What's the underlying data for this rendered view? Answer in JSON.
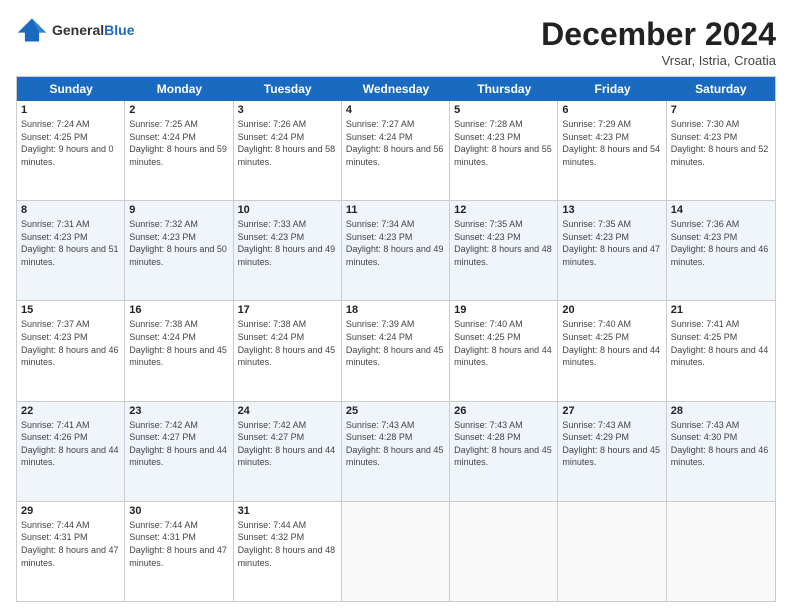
{
  "header": {
    "logo_general": "General",
    "logo_blue": "Blue",
    "title": "December 2024",
    "location": "Vrsar, Istria, Croatia"
  },
  "weekdays": [
    "Sunday",
    "Monday",
    "Tuesday",
    "Wednesday",
    "Thursday",
    "Friday",
    "Saturday"
  ],
  "rows": [
    [
      {
        "day": "1",
        "sunrise": "7:24 AM",
        "sunset": "4:25 PM",
        "daylight": "9 hours and 0 minutes."
      },
      {
        "day": "2",
        "sunrise": "7:25 AM",
        "sunset": "4:24 PM",
        "daylight": "8 hours and 59 minutes."
      },
      {
        "day": "3",
        "sunrise": "7:26 AM",
        "sunset": "4:24 PM",
        "daylight": "8 hours and 58 minutes."
      },
      {
        "day": "4",
        "sunrise": "7:27 AM",
        "sunset": "4:24 PM",
        "daylight": "8 hours and 56 minutes."
      },
      {
        "day": "5",
        "sunrise": "7:28 AM",
        "sunset": "4:23 PM",
        "daylight": "8 hours and 55 minutes."
      },
      {
        "day": "6",
        "sunrise": "7:29 AM",
        "sunset": "4:23 PM",
        "daylight": "8 hours and 54 minutes."
      },
      {
        "day": "7",
        "sunrise": "7:30 AM",
        "sunset": "4:23 PM",
        "daylight": "8 hours and 52 minutes."
      }
    ],
    [
      {
        "day": "8",
        "sunrise": "7:31 AM",
        "sunset": "4:23 PM",
        "daylight": "8 hours and 51 minutes."
      },
      {
        "day": "9",
        "sunrise": "7:32 AM",
        "sunset": "4:23 PM",
        "daylight": "8 hours and 50 minutes."
      },
      {
        "day": "10",
        "sunrise": "7:33 AM",
        "sunset": "4:23 PM",
        "daylight": "8 hours and 49 minutes."
      },
      {
        "day": "11",
        "sunrise": "7:34 AM",
        "sunset": "4:23 PM",
        "daylight": "8 hours and 49 minutes."
      },
      {
        "day": "12",
        "sunrise": "7:35 AM",
        "sunset": "4:23 PM",
        "daylight": "8 hours and 48 minutes."
      },
      {
        "day": "13",
        "sunrise": "7:35 AM",
        "sunset": "4:23 PM",
        "daylight": "8 hours and 47 minutes."
      },
      {
        "day": "14",
        "sunrise": "7:36 AM",
        "sunset": "4:23 PM",
        "daylight": "8 hours and 46 minutes."
      }
    ],
    [
      {
        "day": "15",
        "sunrise": "7:37 AM",
        "sunset": "4:23 PM",
        "daylight": "8 hours and 46 minutes."
      },
      {
        "day": "16",
        "sunrise": "7:38 AM",
        "sunset": "4:24 PM",
        "daylight": "8 hours and 45 minutes."
      },
      {
        "day": "17",
        "sunrise": "7:38 AM",
        "sunset": "4:24 PM",
        "daylight": "8 hours and 45 minutes."
      },
      {
        "day": "18",
        "sunrise": "7:39 AM",
        "sunset": "4:24 PM",
        "daylight": "8 hours and 45 minutes."
      },
      {
        "day": "19",
        "sunrise": "7:40 AM",
        "sunset": "4:25 PM",
        "daylight": "8 hours and 44 minutes."
      },
      {
        "day": "20",
        "sunrise": "7:40 AM",
        "sunset": "4:25 PM",
        "daylight": "8 hours and 44 minutes."
      },
      {
        "day": "21",
        "sunrise": "7:41 AM",
        "sunset": "4:25 PM",
        "daylight": "8 hours and 44 minutes."
      }
    ],
    [
      {
        "day": "22",
        "sunrise": "7:41 AM",
        "sunset": "4:26 PM",
        "daylight": "8 hours and 44 minutes."
      },
      {
        "day": "23",
        "sunrise": "7:42 AM",
        "sunset": "4:27 PM",
        "daylight": "8 hours and 44 minutes."
      },
      {
        "day": "24",
        "sunrise": "7:42 AM",
        "sunset": "4:27 PM",
        "daylight": "8 hours and 44 minutes."
      },
      {
        "day": "25",
        "sunrise": "7:43 AM",
        "sunset": "4:28 PM",
        "daylight": "8 hours and 45 minutes."
      },
      {
        "day": "26",
        "sunrise": "7:43 AM",
        "sunset": "4:28 PM",
        "daylight": "8 hours and 45 minutes."
      },
      {
        "day": "27",
        "sunrise": "7:43 AM",
        "sunset": "4:29 PM",
        "daylight": "8 hours and 45 minutes."
      },
      {
        "day": "28",
        "sunrise": "7:43 AM",
        "sunset": "4:30 PM",
        "daylight": "8 hours and 46 minutes."
      }
    ],
    [
      {
        "day": "29",
        "sunrise": "7:44 AM",
        "sunset": "4:31 PM",
        "daylight": "8 hours and 47 minutes."
      },
      {
        "day": "30",
        "sunrise": "7:44 AM",
        "sunset": "4:31 PM",
        "daylight": "8 hours and 47 minutes."
      },
      {
        "day": "31",
        "sunrise": "7:44 AM",
        "sunset": "4:32 PM",
        "daylight": "8 hours and 48 minutes."
      },
      null,
      null,
      null,
      null
    ]
  ],
  "labels": {
    "sunrise": "Sunrise:",
    "sunset": "Sunset:",
    "daylight": "Daylight:"
  }
}
